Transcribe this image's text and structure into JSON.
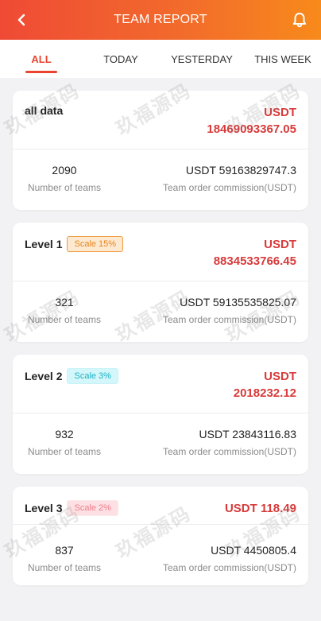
{
  "header": {
    "title": "TEAM REPORT",
    "back_icon": "chevron-left-icon",
    "bell_icon": "bell-icon"
  },
  "tabs": [
    {
      "label": "ALL",
      "active": true
    },
    {
      "label": "TODAY",
      "active": false
    },
    {
      "label": "YESTERDAY",
      "active": false
    },
    {
      "label": "THIS WEEK",
      "active": false
    }
  ],
  "cards": [
    {
      "label": "all data",
      "scale": "",
      "currency": "USDT",
      "amount": "18469093367.05",
      "teams_value": "2090",
      "teams_label": "Number of teams",
      "commission_value": "USDT 59163829747.3",
      "commission_label": "Team order commission(USDT)"
    },
    {
      "label": "Level 1",
      "scale": "Scale 15%",
      "currency": "USDT",
      "amount": "8834533766.45",
      "teams_value": "321",
      "teams_label": "Number of teams",
      "commission_value": "USDT 59135535825.07",
      "commission_label": "Team order commission(USDT)"
    },
    {
      "label": "Level 2",
      "scale": "Scale 3%",
      "currency": "USDT",
      "amount": "2018232.12",
      "teams_value": "932",
      "teams_label": "Number of teams",
      "commission_value": "USDT 23843116.83",
      "commission_label": "Team order commission(USDT)"
    },
    {
      "label": "Level 3",
      "scale": "Scale 2%",
      "currency_amount": "USDT 118.49",
      "teams_value": "837",
      "teams_label": "Number of teams",
      "commission_value": "USDT 4450805.4",
      "commission_label": "Team order commission(USDT)"
    }
  ],
  "watermark": {
    "text": "玖福源码"
  },
  "colors": {
    "accent": "#e8442f",
    "amount": "#d83a3a",
    "header_start": "#ef4a35",
    "header_end": "#f88a1b"
  }
}
